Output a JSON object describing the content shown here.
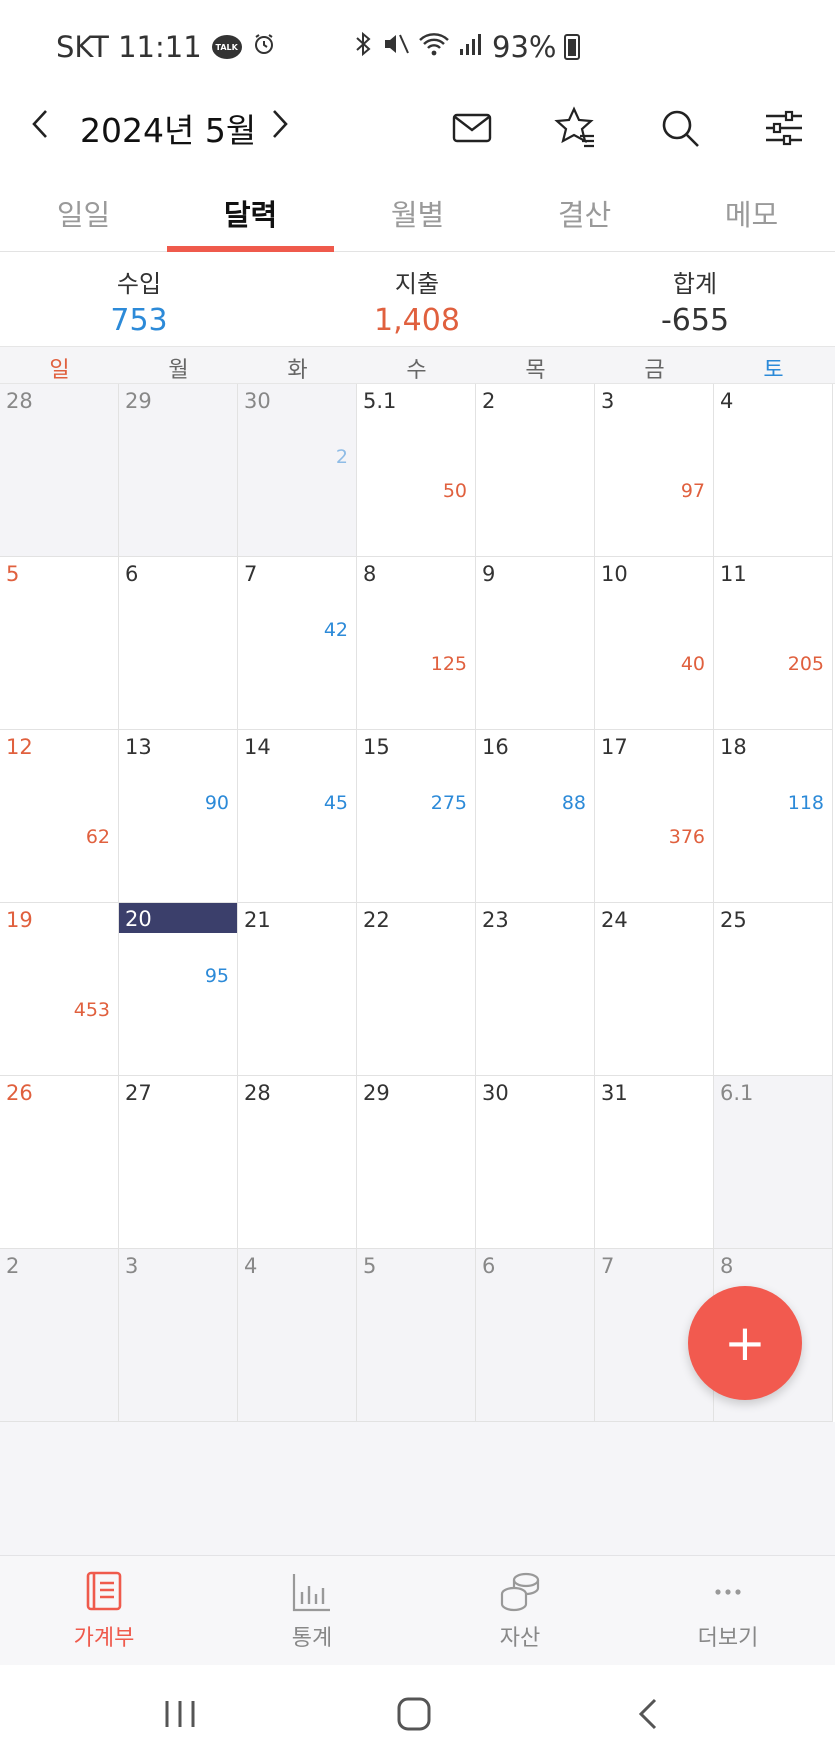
{
  "status": {
    "carrier_time": "SKT 11:11",
    "talk_badge": "TALK",
    "battery": "93%"
  },
  "header": {
    "month_title": "2024년 5월"
  },
  "tabs": [
    {
      "label": "일일"
    },
    {
      "label": "달력"
    },
    {
      "label": "월별"
    },
    {
      "label": "결산"
    },
    {
      "label": "메모"
    }
  ],
  "summary": {
    "income_label": "수입",
    "income_value": "753",
    "expense_label": "지출",
    "expense_value": "1,408",
    "total_label": "합계",
    "total_value": "-655"
  },
  "colors": {
    "income": "#2c8ad8",
    "expense": "#e0603e",
    "accent": "#ef5a4c",
    "today": "#3b3f6b",
    "saturday": "#2c8ad8"
  },
  "weekdays": [
    "일",
    "월",
    "화",
    "수",
    "목",
    "금",
    "토"
  ],
  "calendar": [
    [
      {
        "day": "28",
        "outside": true
      },
      {
        "day": "29",
        "outside": true
      },
      {
        "day": "30",
        "outside": true,
        "income": "2"
      },
      {
        "day": "5.1",
        "expense": "50"
      },
      {
        "day": "2"
      },
      {
        "day": "3",
        "expense": "97"
      },
      {
        "day": "4"
      }
    ],
    [
      {
        "day": "5"
      },
      {
        "day": "6"
      },
      {
        "day": "7",
        "income": "42"
      },
      {
        "day": "8",
        "expense": "125"
      },
      {
        "day": "9"
      },
      {
        "day": "10",
        "expense": "40"
      },
      {
        "day": "11",
        "expense": "205"
      }
    ],
    [
      {
        "day": "12",
        "expense": "62"
      },
      {
        "day": "13",
        "income": "90"
      },
      {
        "day": "14",
        "income": "45"
      },
      {
        "day": "15",
        "income": "275"
      },
      {
        "day": "16",
        "income": "88"
      },
      {
        "day": "17",
        "expense": "376"
      },
      {
        "day": "18",
        "income": "118"
      }
    ],
    [
      {
        "day": "19",
        "expense": "453"
      },
      {
        "day": "20",
        "income": "95",
        "today": true
      },
      {
        "day": "21"
      },
      {
        "day": "22"
      },
      {
        "day": "23"
      },
      {
        "day": "24"
      },
      {
        "day": "25"
      }
    ],
    [
      {
        "day": "26"
      },
      {
        "day": "27"
      },
      {
        "day": "28"
      },
      {
        "day": "29"
      },
      {
        "day": "30"
      },
      {
        "day": "31"
      },
      {
        "day": "6.1",
        "outside": true
      }
    ],
    [
      {
        "day": "2",
        "outside": true
      },
      {
        "day": "3",
        "outside": true
      },
      {
        "day": "4",
        "outside": true
      },
      {
        "day": "5",
        "outside": true
      },
      {
        "day": "6",
        "outside": true
      },
      {
        "day": "7",
        "outside": true
      },
      {
        "day": "8",
        "outside": true
      }
    ]
  ],
  "fab": {
    "label": "+"
  },
  "bottom_nav": [
    {
      "label": "가계부",
      "icon": "book-icon",
      "active": true
    },
    {
      "label": "통계",
      "icon": "bar-chart-icon"
    },
    {
      "label": "자산",
      "icon": "coins-icon"
    },
    {
      "label": "더보기",
      "icon": "more-icon"
    }
  ]
}
